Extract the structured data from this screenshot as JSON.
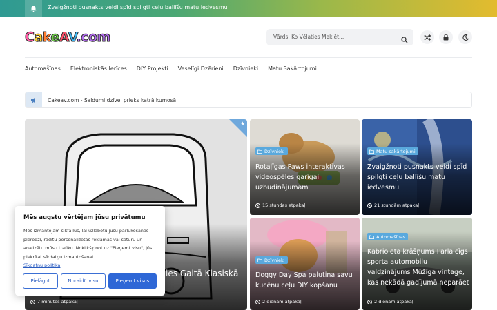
{
  "topbar": {
    "ticker": "Zvaigžņoti pusnakts veidi spīd spilgti ceļu ballīšu matu iedvesmu"
  },
  "header": {
    "logo_text": "CakeAV.com",
    "search_placeholder": "Vārds, Ko Vēlaties Meklēt..."
  },
  "nav": {
    "items": [
      "Automašīnas",
      "Elektroniskās Ierīces",
      "DIY Projekti",
      "Veselīgi Dzērieni",
      "Dzīvnieki",
      "Matu Sakārtojumi"
    ]
  },
  "announcement": {
    "text": "Cakeav.com - Saldumi dzīvei prieks katrā kumosā"
  },
  "cards": [
    {
      "title": "…ies Gaitā Klasiskā",
      "time": "7 minūtes atpakaļ"
    },
    {
      "category": "Dzīvnieki",
      "title": "Rotaļīgas Paws interaktīvas videospēles garīgai uzbudinājumam",
      "time": "15 stundas atpakaļ"
    },
    {
      "category": "Matu sakārtojumi",
      "title": "Zvaigžņoti pusnakts veidi spīd spilgti ceļu ballīšu matu iedvesmu",
      "time": "21 stundām atpakaļ"
    },
    {
      "category": "Dzīvnieki",
      "title": "Doggy Day Spa palutina savu kucēnu ceļu DIY kopšanu",
      "time": "2 dienām atpakaļ"
    },
    {
      "category": "Automašīnas",
      "title": "Kabrioleta krāšņums Parlaicīgs sporta automobiļu valdzinājums Mūžīga vintage, kas nekādā gadījumā neparāet",
      "time": "2 dienām atpakaļ"
    }
  ],
  "cookie": {
    "title": "Mēs augstu vērtējam jūsu privātumu",
    "body": "Mēs izmantojam sīkfailus, lai uzlabotu jūsu pārlūkošanas pieredzi, rādītu personalizētas reklāmas vai saturu un analizētu mūsu trafiku. Noklikšķinot uz \"Pieņemt visu\", jūs piekrītat sīkdatņu izmantošanai.",
    "link": "Sīkdatņu politika",
    "btn_customize": "Pielāgot",
    "btn_reject": "Noraidīt visu",
    "btn_accept": "Pieņemt visus"
  },
  "colors": {
    "accent": "#2e67d6",
    "badge": "#5aa9dd"
  }
}
